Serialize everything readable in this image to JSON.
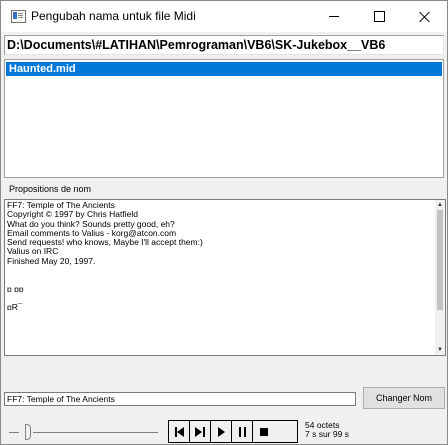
{
  "window": {
    "title": "Pengubah nama untuk file Midi",
    "icon": "app-icon"
  },
  "path": {
    "value": "D:\\Documents\\#LATIHAN\\Pemrograman\\VB6\\SK-Jukebox__VB6"
  },
  "file_list": {
    "items": [
      {
        "label": "Haunted.mid",
        "selected": true
      }
    ]
  },
  "propositions": {
    "label": "Propositions de nom",
    "lines": [
      "FF7: Temple of The Ancients",
      "Copyright © 1997 by Chris Hatfield",
      "What do you think? Sounds pretty good, eh?",
      "Email comments to Valius - korg@atcon.com",
      "Send requests! who knows, Maybe I'll accept them:)",
      "Valius on IRC",
      "Finished May 20, 1997.",
      "",
      "",
      "ɒ ɒɒ",
      "",
      "ɒR¯"
    ]
  },
  "name_input": {
    "value": "FF7: Temple of The Ancients"
  },
  "buttons": {
    "change_name": "Changer Nom"
  },
  "player": {
    "controls": [
      "skip-back",
      "play-pause",
      "play",
      "pause",
      "stop"
    ],
    "size": "54 octets",
    "time": "7 s sur 99 s"
  }
}
